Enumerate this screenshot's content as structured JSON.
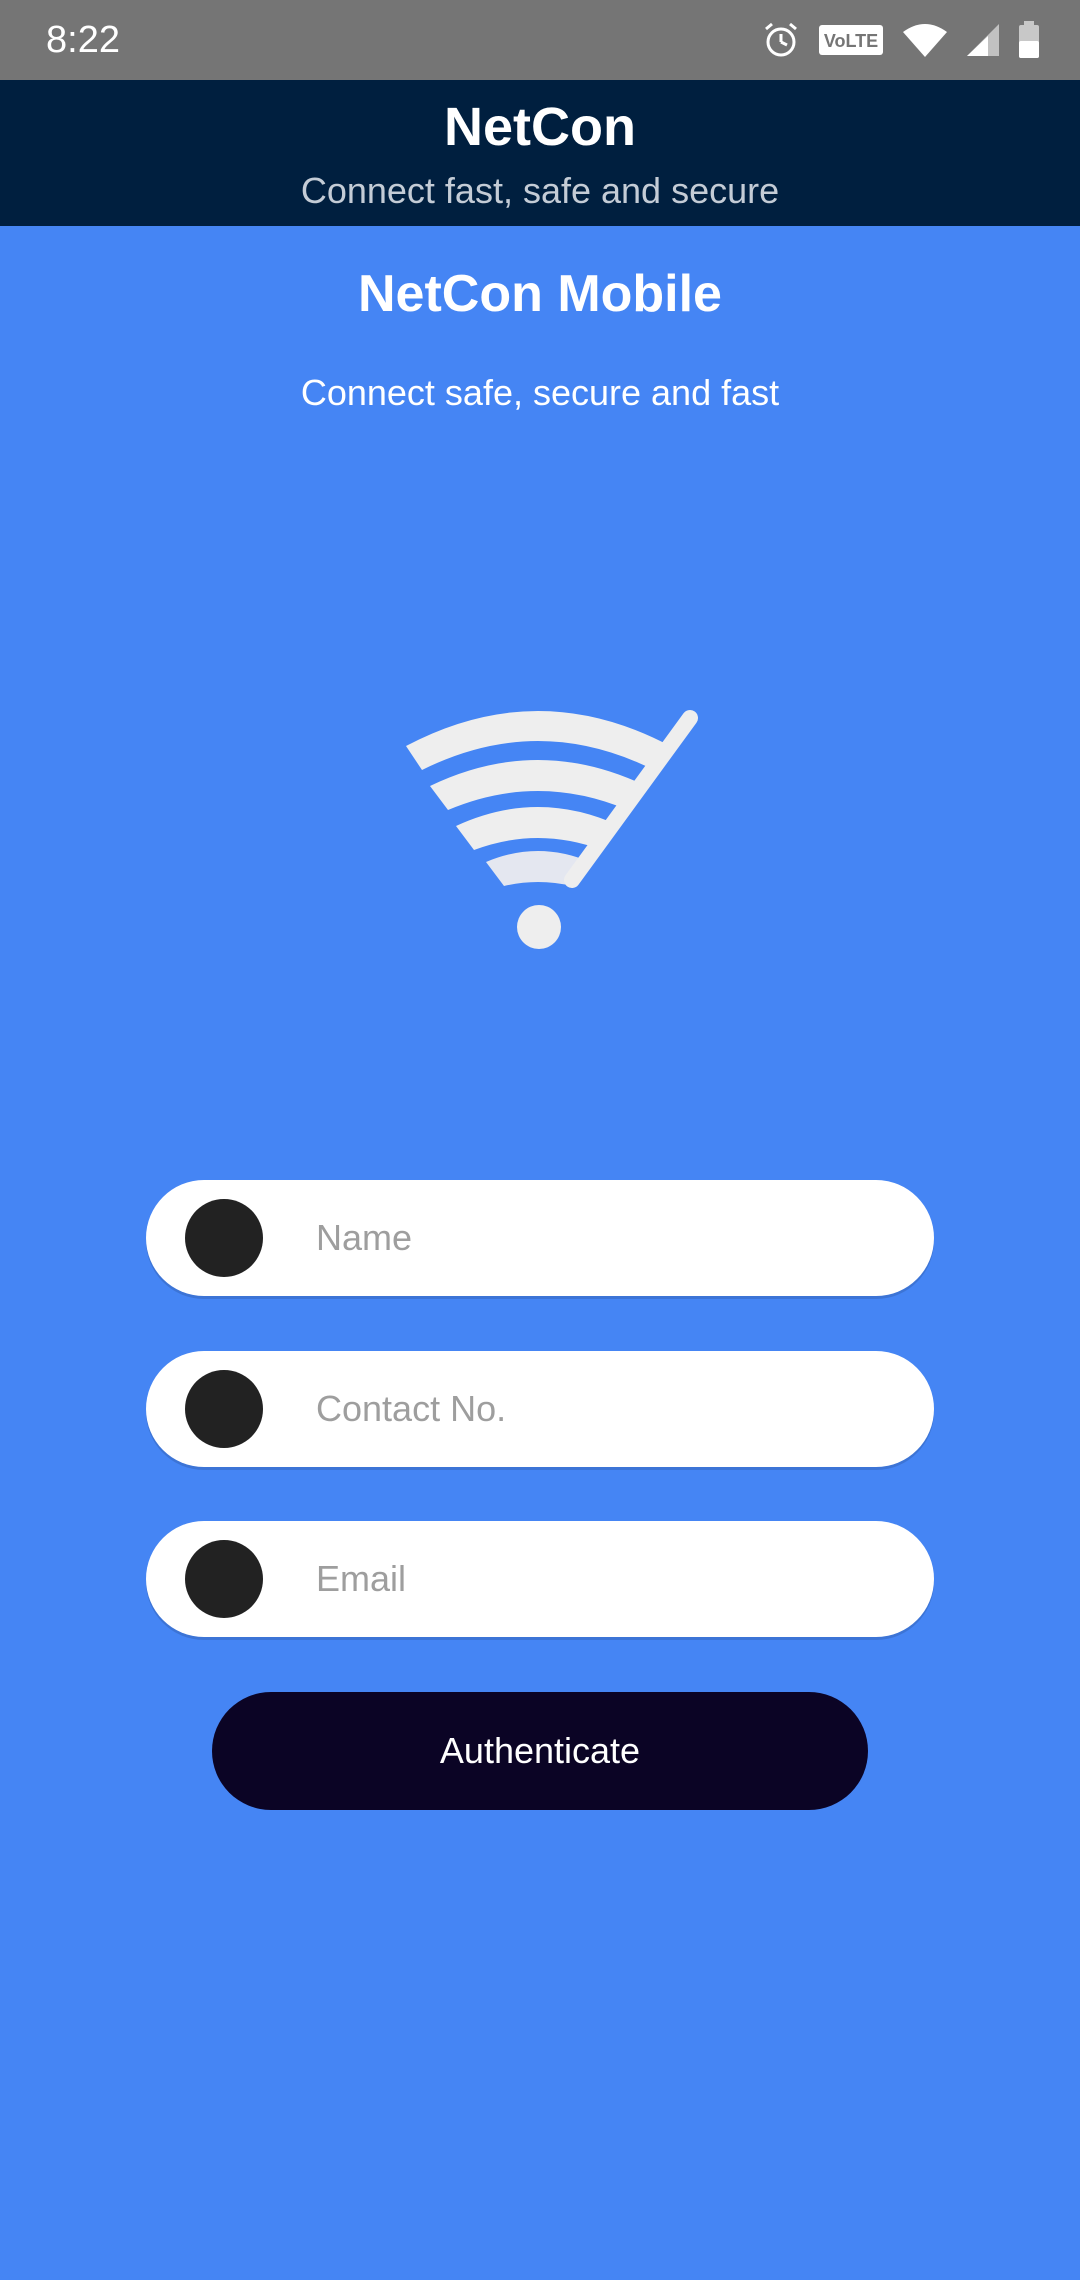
{
  "status_bar": {
    "time": "8:22",
    "icons": [
      "alarm-icon",
      "volte-icon",
      "wifi-icon",
      "cell-signal-icon",
      "battery-icon"
    ],
    "volte_label": "VoLTE"
  },
  "app_bar": {
    "title": "NetCon",
    "subtitle": "Connect fast, safe and secure"
  },
  "main": {
    "heading": "NetCon Mobile",
    "tagline": "Connect safe, secure and fast",
    "graphic_icon": "wifi-off-icon"
  },
  "form": {
    "fields": [
      {
        "name": "name",
        "value": "",
        "placeholder": "Name"
      },
      {
        "name": "contact",
        "value": "",
        "placeholder": "Contact No."
      },
      {
        "name": "email",
        "value": "",
        "placeholder": "Email"
      }
    ],
    "submit_label": "Authenticate"
  },
  "colors": {
    "background": "#4585f4",
    "app_bar": "#001f3f",
    "status_bar": "#757575",
    "button": "#0b0425",
    "field": "#ffffff",
    "field_icon": "#222222"
  }
}
